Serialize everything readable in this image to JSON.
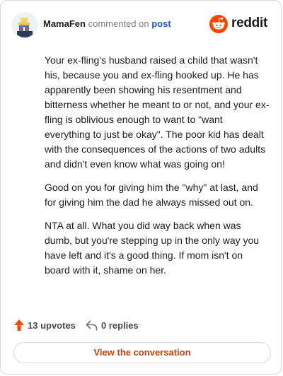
{
  "comment": {
    "username": "MamaFen",
    "commented_on": "commented on",
    "post_link": "post",
    "paragraphs": [
      "Your ex-fling's husband raised a child that wasn't his, because you and ex-fling hooked up. He has apparently been showing his resentment and bitterness whether he meant to or not, and your ex-fling is oblivious enough to want to \"want everything to just be okay\". The poor kid has dealt with the consequences of the actions of two adults and didn't even know what was going on!",
      "Good on you for giving him the \"why\" at last, and for giving him the dad he always missed out on.",
      "NTA at all. What you did way back when was dumb, but you're stepping up in the only way you have left and it's a good thing. If mom isn't on board with it, shame on her."
    ]
  },
  "brand": {
    "wordmark": "reddit",
    "color": "#ff4500"
  },
  "actions": {
    "upvotes": "13 upvotes",
    "replies": "0 replies",
    "upvote_icon": "upvote-arrow-icon",
    "reply_icon": "reply-arrow-icon"
  },
  "cta": {
    "label": "View the conversation"
  },
  "colors": {
    "accent": "#ff4500",
    "link": "#1c5bc4",
    "cta_text": "#c6410b"
  }
}
